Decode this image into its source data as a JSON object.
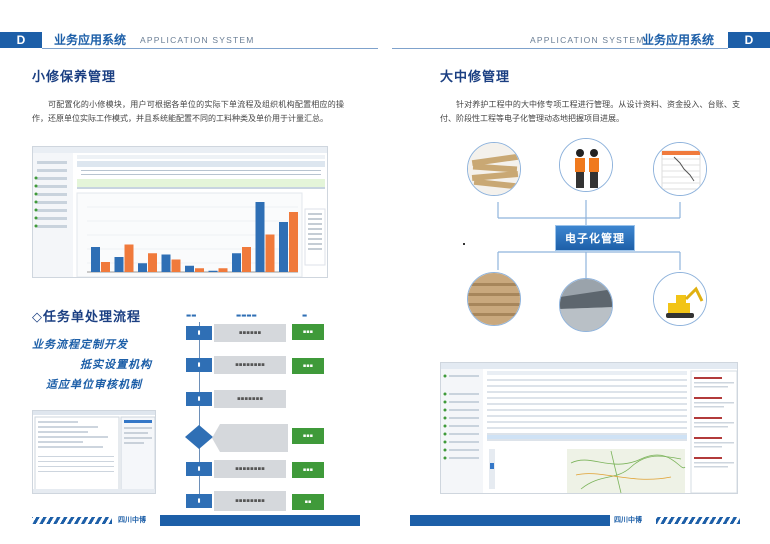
{
  "left_page": {
    "badge": "D",
    "title": "业务应用系统",
    "subtitle": "APPLICATION SYSTEM",
    "section1": {
      "title": "小修保养管理",
      "paragraph": "可配置化的小修模块，用户可根据各单位的实际下单流程及组织机构配置相应的操作，还原单位实际工作模式，并且系统能配置不同的工料种类及单价用于计量汇总。"
    },
    "section2": {
      "title": "◇任务单处理流程",
      "slogans": [
        "业务流程定制开发",
        "抵实设置机构",
        "适应单位审核机制"
      ]
    },
    "footer": "四川中博"
  },
  "right_page": {
    "badge": "D",
    "title": "业务应用系统",
    "subtitle": "APPLICATION SYSTEM",
    "section1": {
      "title": "大中修管理",
      "paragraph": "针对养护工程中的大中修专项工程进行管理。从设计资料、资金投入、台账、支付、阶段性工程等电子化管理动态地把握项目进展。",
      "hub_label": "电子化管理"
    },
    "footer": "四川中博"
  },
  "chart_data": {
    "type": "bar",
    "series": [
      {
        "values": [
          2,
          1.2,
          0.7,
          1.4,
          0.5,
          0.1,
          1.5,
          5.6,
          4
        ]
      },
      {
        "values": [
          0.8,
          2.2,
          1.5,
          1,
          0.3,
          0.3,
          2,
          3,
          4.8
        ]
      }
    ],
    "colors": [
      "#2f6fb5",
      "#f07a3c"
    ],
    "ylim": [
      0,
      6
    ]
  },
  "colors": {
    "brand_blue": "#1d5fa8",
    "title_navy": "#1b3f82",
    "flow_green": "#3f9a3a"
  }
}
